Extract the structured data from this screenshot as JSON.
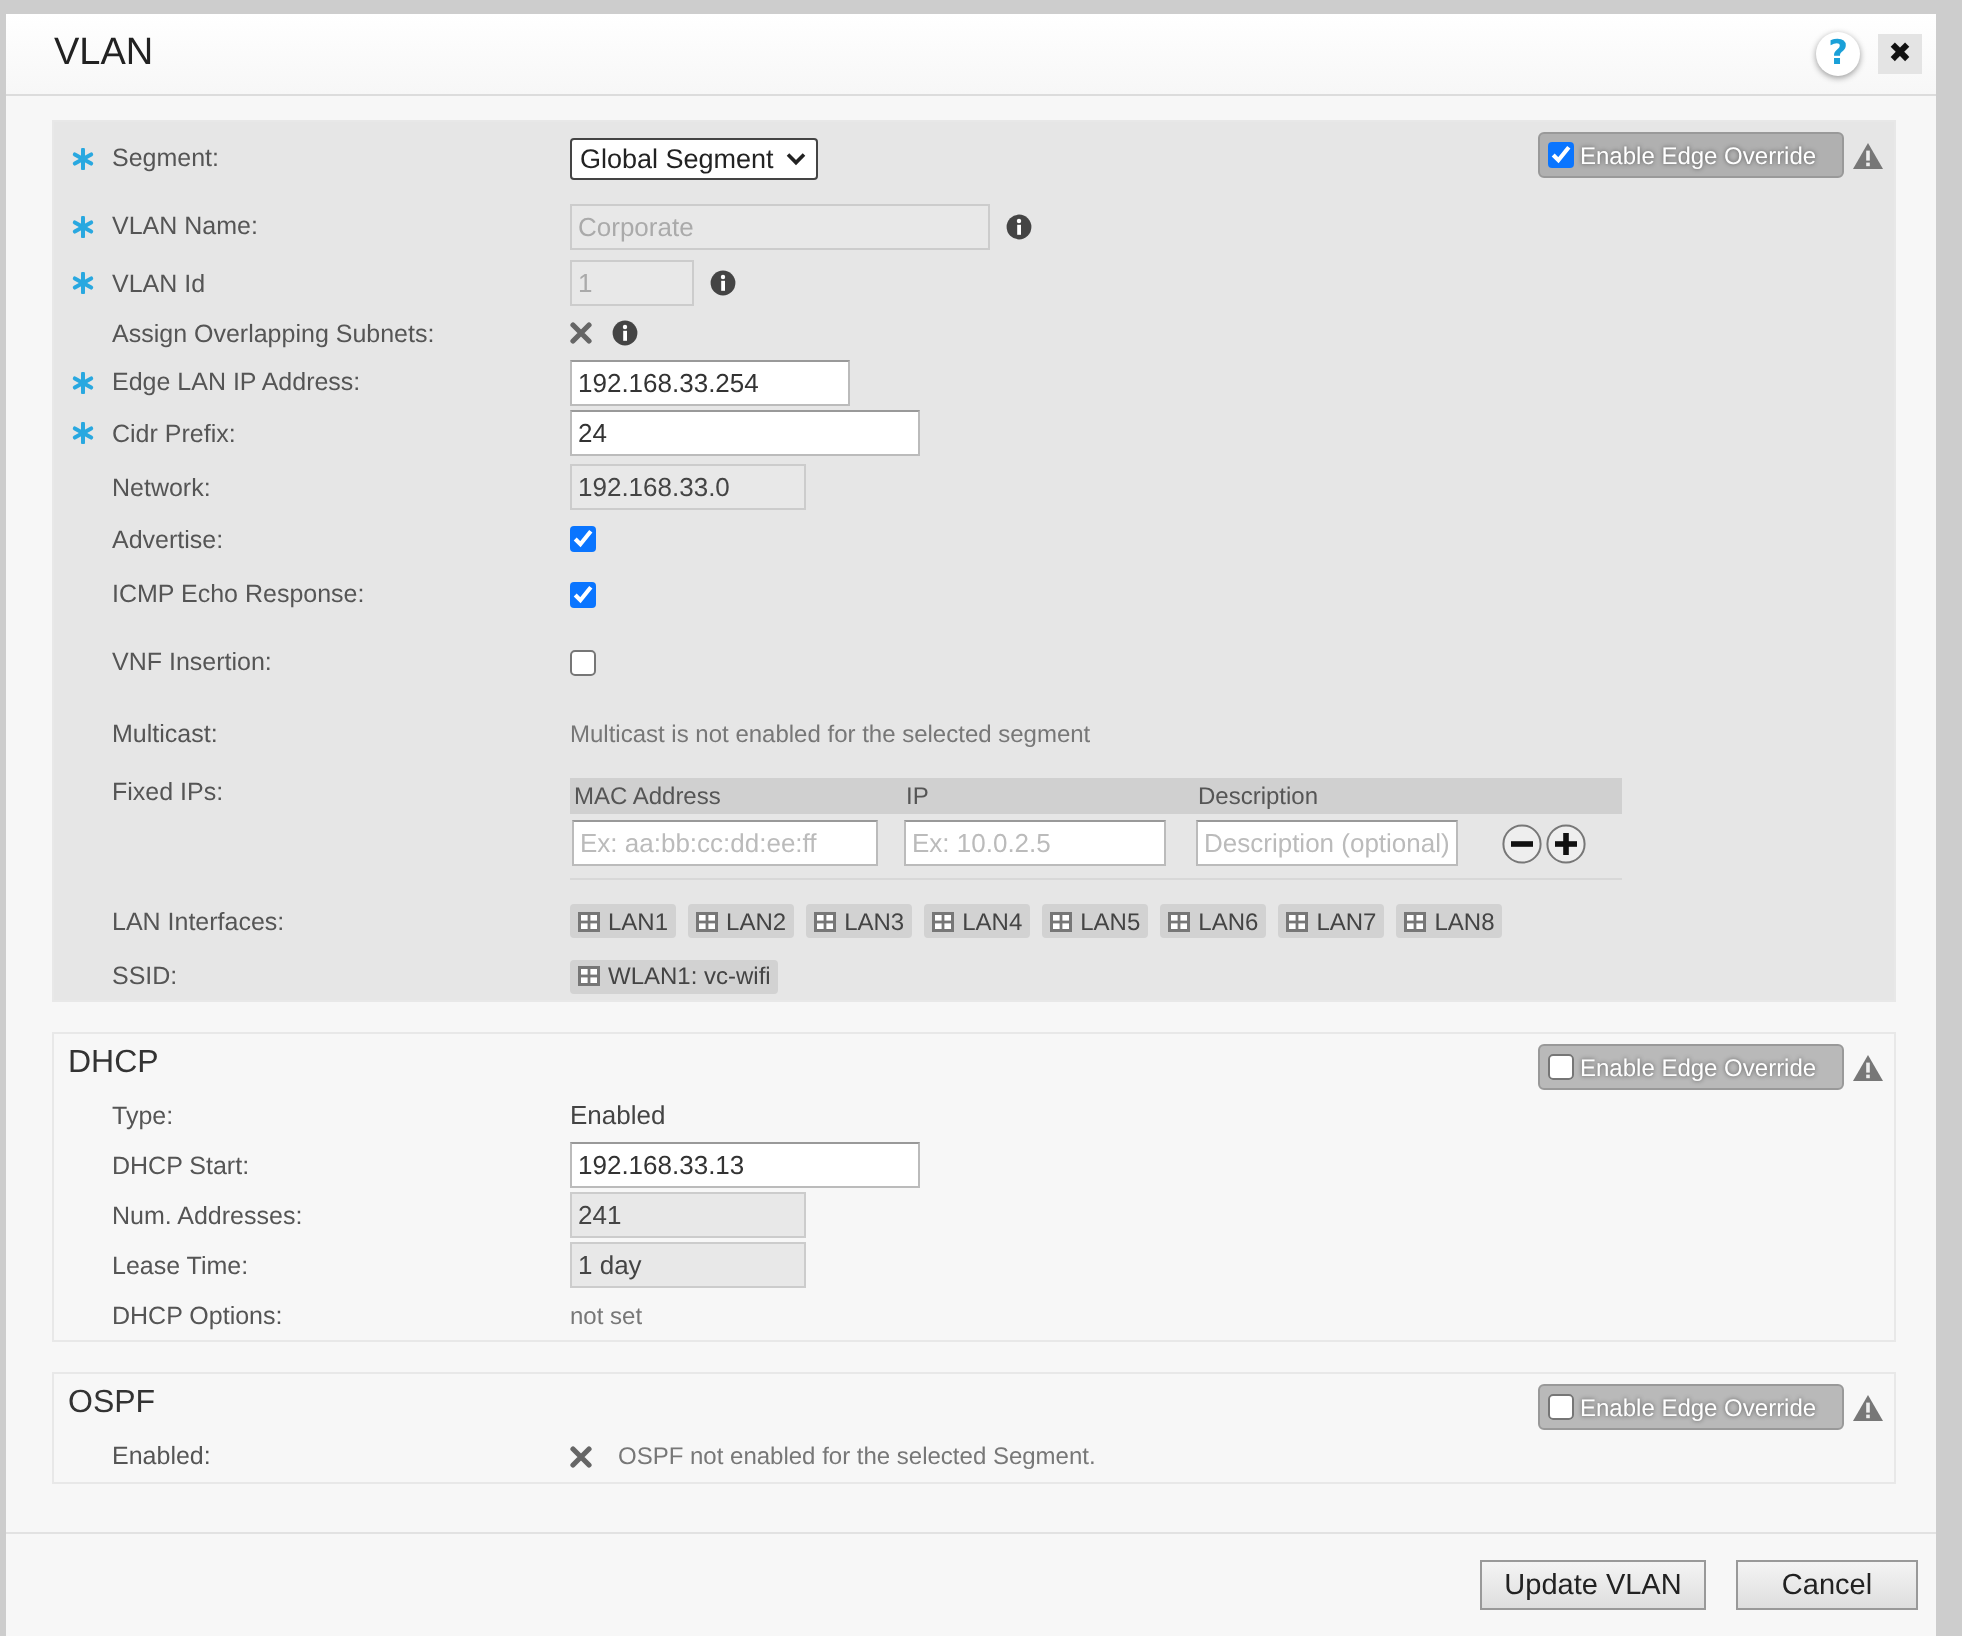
{
  "window": {
    "title": "VLAN",
    "help_button": "?",
    "close_button": "✖"
  },
  "sections": [
    {
      "edge_override": {
        "label": "Enable Edge Override",
        "checked": true
      },
      "rows": [
        {
          "kind": "select",
          "label": "Segment:",
          "required": true,
          "value": "Global Segment"
        },
        {
          "kind": "input",
          "label": "VLAN Name:",
          "required": true,
          "value": "Corporate",
          "disabled": true,
          "info": true
        },
        {
          "kind": "input",
          "label": "VLAN Id",
          "required": true,
          "value": "1",
          "disabled": true,
          "info": true
        },
        {
          "kind": "cross",
          "label": "Assign Overlapping Subnets:",
          "required": false,
          "info": true
        },
        {
          "kind": "input",
          "label": "Edge LAN IP Address:",
          "required": true,
          "value": "192.168.33.254",
          "disabled": false
        },
        {
          "kind": "input",
          "label": "Cidr Prefix:",
          "required": true,
          "value": "24",
          "disabled": false
        },
        {
          "kind": "readonly",
          "label": "Network:",
          "required": false,
          "value": "192.168.33.0"
        },
        {
          "kind": "checkbox",
          "label": "Advertise:",
          "required": false,
          "checked": true
        },
        {
          "kind": "checkbox",
          "label": "ICMP Echo Response:",
          "required": false,
          "checked": true
        },
        {
          "kind": "checkbox",
          "label": "VNF Insertion:",
          "required": false,
          "checked": false
        },
        {
          "kind": "note",
          "label": "Multicast:",
          "required": false,
          "value": "Multicast is not enabled for the selected segment"
        },
        {
          "kind": "table",
          "label": "Fixed IPs:",
          "required": false,
          "columns": [
            {
              "header": "MAC Address",
              "placeholder": "Ex: aa:bb:cc:dd:ee:ff"
            },
            {
              "header": "IP",
              "placeholder": "Ex: 10.0.2.5"
            },
            {
              "header": "Description",
              "placeholder": "Description (optional)"
            }
          ]
        },
        {
          "kind": "tags",
          "label": "LAN Interfaces:",
          "required": false,
          "items": [
            "LAN1",
            "LAN2",
            "LAN3",
            "LAN4",
            "LAN5",
            "LAN6",
            "LAN7",
            "LAN8"
          ]
        },
        {
          "kind": "tags",
          "label": "SSID:",
          "required": false,
          "items": [
            "WLAN1: vc-wifi"
          ]
        }
      ]
    },
    {
      "title": "DHCP",
      "edge_override": {
        "label": "Enable Edge Override",
        "checked": false
      },
      "rows": [
        {
          "kind": "text",
          "label": "Type:",
          "required": false,
          "value": "Enabled"
        },
        {
          "kind": "input",
          "label": "DHCP Start:",
          "required": false,
          "value": "192.168.33.13",
          "disabled": false
        },
        {
          "kind": "readonly",
          "label": "Num. Addresses:",
          "required": false,
          "value": "241"
        },
        {
          "kind": "readonly",
          "label": "Lease Time:",
          "required": false,
          "value": "1 day"
        },
        {
          "kind": "note",
          "label": "DHCP Options:",
          "required": false,
          "value": "not set"
        }
      ]
    },
    {
      "title": "OSPF",
      "edge_override": {
        "label": "Enable Edge Override",
        "checked": false
      },
      "rows": [
        {
          "kind": "cross-note",
          "label": "Enabled:",
          "required": false,
          "value": "OSPF not enabled for the selected Segment."
        }
      ]
    }
  ],
  "buttons": [
    "Update VLAN",
    "Cancel"
  ]
}
